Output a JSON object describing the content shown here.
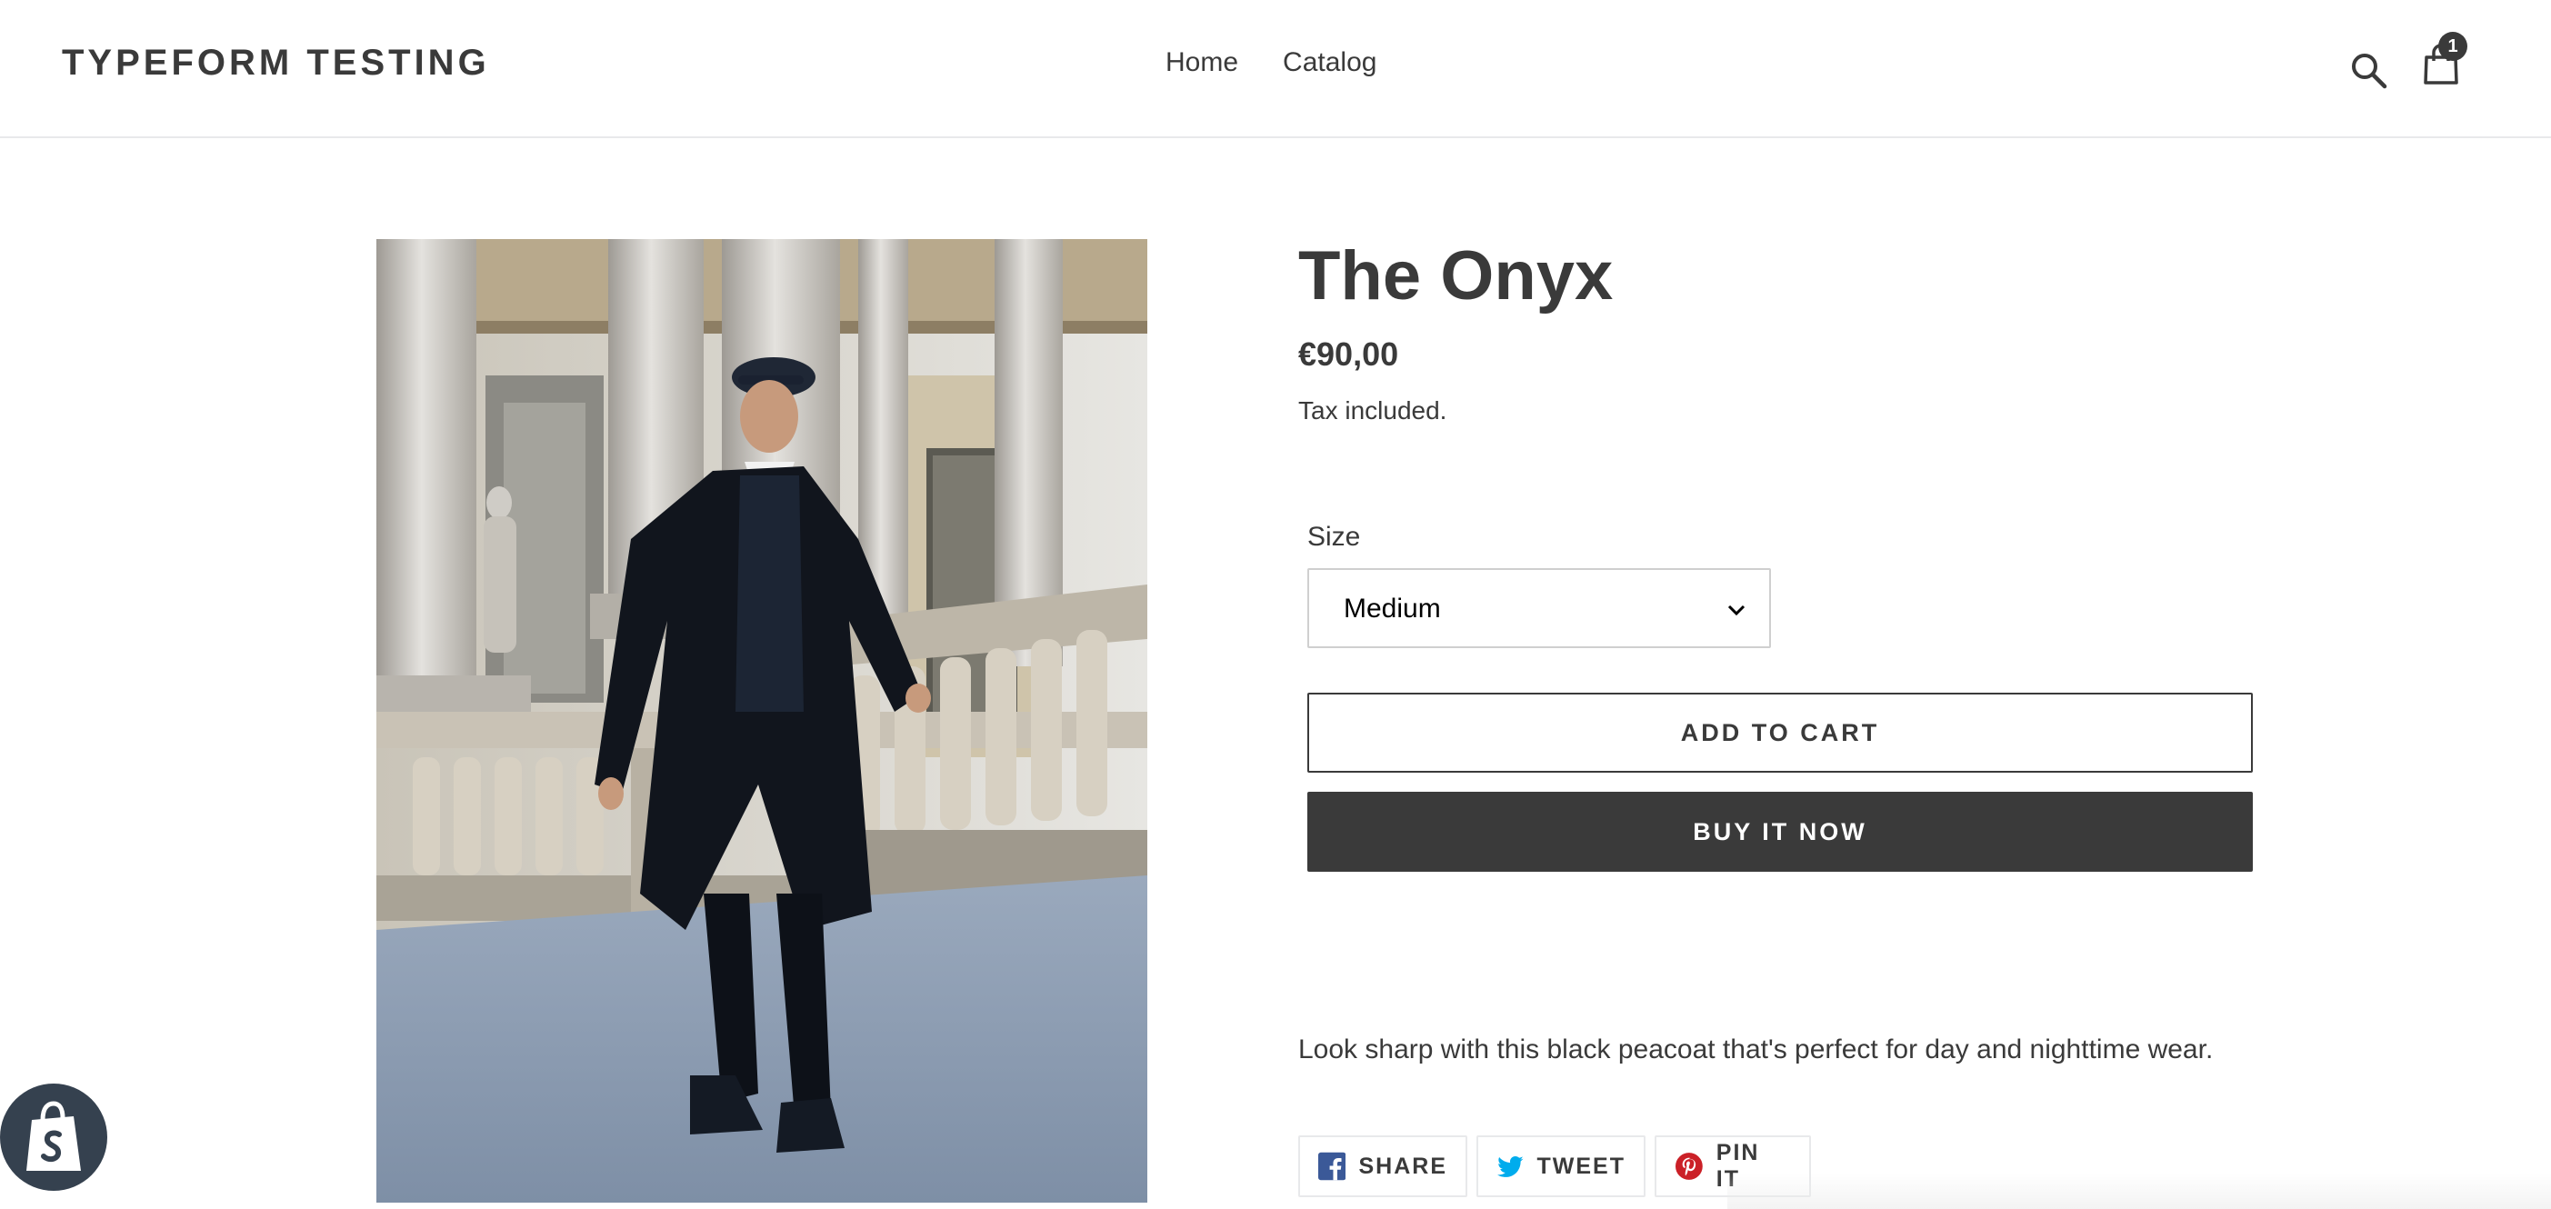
{
  "header": {
    "logo": "TYPEFORM TESTING",
    "nav": [
      {
        "label": "Home"
      },
      {
        "label": "Catalog"
      }
    ],
    "cart_count": "1",
    "search_icon": "search-icon",
    "cart_icon": "shopping-bag-icon"
  },
  "product": {
    "image_alt": "Man in black peacoat walking through a colonnade",
    "title": "The Onyx",
    "price": "€90,00",
    "tax_note": "Tax included.",
    "size": {
      "label": "Size",
      "selected": "Medium"
    },
    "add_to_cart": "ADD TO CART",
    "buy_now": "BUY IT NOW",
    "description": "Look sharp with this black peacoat that's perfect for day and nighttime wear."
  },
  "share": {
    "facebook": "SHARE",
    "twitter": "TWEET",
    "pinterest": "PIN IT"
  },
  "colors": {
    "text": "#3a3a3a",
    "button_dark": "#3a3a3a",
    "facebook": "#3b5998",
    "twitter": "#00aced",
    "pinterest": "#cb2027",
    "shopify_badge": "#35414f"
  }
}
